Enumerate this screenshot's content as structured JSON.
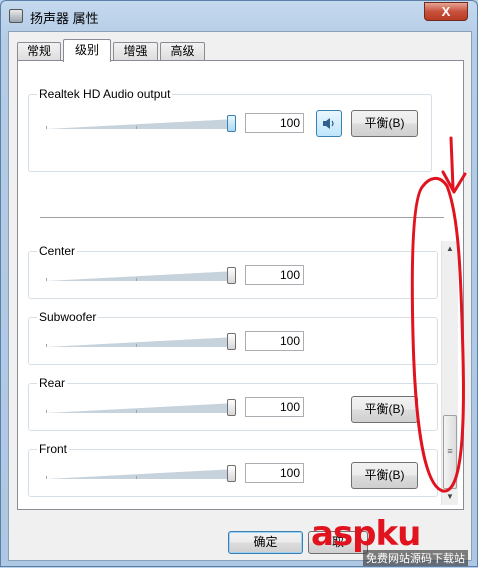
{
  "window": {
    "title": "扬声器 属性",
    "close_glyph": "X"
  },
  "tabs": [
    {
      "label": "常规",
      "active": false
    },
    {
      "label": "级别",
      "active": true
    },
    {
      "label": "增强",
      "active": false
    },
    {
      "label": "高级",
      "active": false
    }
  ],
  "master": {
    "label": "Realtek HD Audio output",
    "value": "100",
    "level": 1.0,
    "balance_label": "平衡(B)",
    "speaker_icon": "speaker-icon"
  },
  "channels": [
    {
      "label": "Center",
      "value": "100",
      "level": 1.0,
      "has_balance": false
    },
    {
      "label": "Subwoofer",
      "value": "100",
      "level": 1.0,
      "has_balance": false
    },
    {
      "label": "Rear",
      "value": "100",
      "level": 1.0,
      "has_balance": true,
      "balance_label": "平衡(B)"
    },
    {
      "label": "Front",
      "value": "100",
      "level": 1.0,
      "has_balance": true,
      "balance_label": "平衡(B)"
    }
  ],
  "scrollbar": {
    "up_glyph": "▲",
    "down_glyph": "▼",
    "grip_glyph": "≡"
  },
  "footer": {
    "ok_label": "确定",
    "cancel_label": "取"
  },
  "watermark": {
    "text": "aspku",
    "sub": "免费网站源码下载站"
  },
  "colors": {
    "accent_blue": "#3c7fb1",
    "annotation_red": "#e0131f"
  }
}
